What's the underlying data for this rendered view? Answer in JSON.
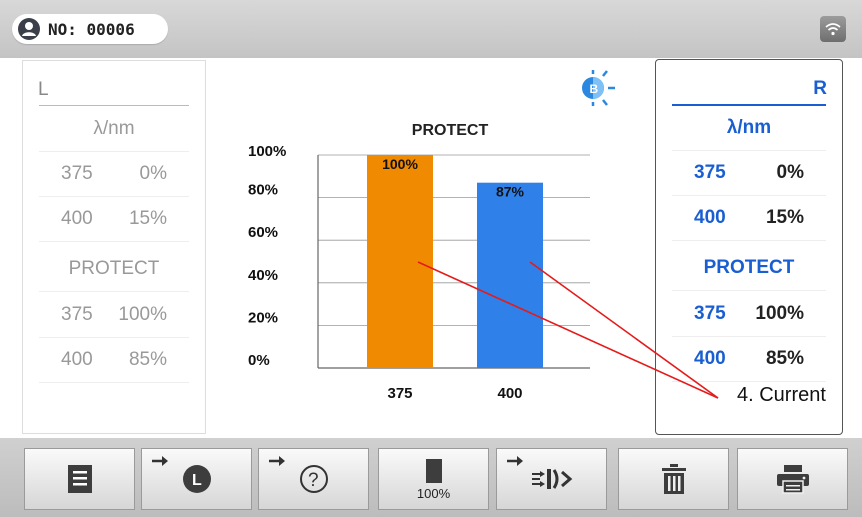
{
  "header": {
    "id_label": "NO: 00006",
    "wifi_icon": "wifi-icon",
    "user_icon": "user-icon"
  },
  "left": {
    "side": "L",
    "unit": "λ/nm",
    "rows": [
      {
        "wl": "375",
        "val": "0%"
      },
      {
        "wl": "400",
        "val": "15%"
      }
    ],
    "protect_label": "PROTECT",
    "protect_rows": [
      {
        "wl": "375",
        "val": "100%"
      },
      {
        "wl": "400",
        "val": "85%"
      }
    ]
  },
  "right": {
    "side": "R",
    "unit": "λ/nm",
    "rows": [
      {
        "wl": "375",
        "val": "0%"
      },
      {
        "wl": "400",
        "val": "15%"
      }
    ],
    "protect_label": "PROTECT",
    "protect_rows": [
      {
        "wl": "375",
        "val": "100%"
      },
      {
        "wl": "400",
        "val": "85%"
      }
    ]
  },
  "bulb_icon": "blue-light-bulb-icon",
  "annotation": "4. Current",
  "chart_data": {
    "type": "bar",
    "title": "PROTECT",
    "categories": [
      "375",
      "400"
    ],
    "values": [
      100,
      87
    ],
    "value_labels": [
      "100%",
      "87%"
    ],
    "colors": [
      "#f08a00",
      "#2f80e8"
    ],
    "yticks": [
      "0%",
      "20%",
      "40%",
      "60%",
      "80%",
      "100%"
    ],
    "ylim": [
      0,
      100
    ],
    "grid": true
  },
  "toolbar": [
    {
      "icon": "list-icon"
    },
    {
      "icon": "arrow-left-lens-icon"
    },
    {
      "icon": "arrow-help-icon"
    },
    {
      "icon": "full-bar-icon",
      "label": "100%"
    },
    {
      "icon": "arrow-light-transmit-icon"
    },
    {
      "icon": "trash-icon"
    },
    {
      "icon": "printer-icon"
    }
  ]
}
